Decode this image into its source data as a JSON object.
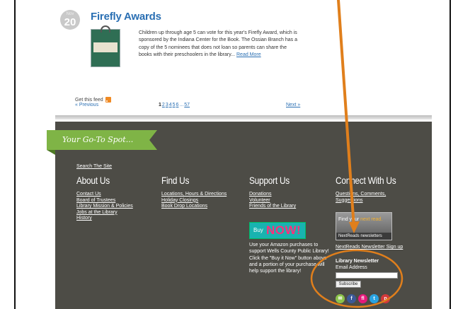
{
  "post": {
    "date_month": "Nov",
    "date_day": "20",
    "title": "Firefly Awards",
    "body": "Children up through age 5 can vote for this year's Firefly Award, which is sponsored by the Indiana Center for the Book. The Ossian Branch has a copy of the 5 nominees that does not loan so parents can share the books with their preschoolers in the library...",
    "read_more": "Read More"
  },
  "feed": {
    "label": "Get this feed",
    "icon": "rss-icon"
  },
  "pagination": {
    "previous": "« Previous",
    "pages": [
      "1",
      "2",
      "3",
      "4",
      "5",
      "6",
      "...",
      "57"
    ],
    "current": "1",
    "next": "Next »"
  },
  "footer": {
    "tagline": "Your Go-To Spot...",
    "search_link": "Search The Site",
    "about": {
      "heading": "About Us",
      "links": [
        "Contact Us",
        "Board of Trustees",
        "Library Mission & Policies",
        "Jobs at the Library",
        "History"
      ]
    },
    "find": {
      "heading": "Find Us",
      "links": [
        "Locations, Hours & Directions",
        "Holiday Closings",
        "Book Drop Locations"
      ]
    },
    "support": {
      "heading": "Support Us",
      "links": [
        "Donations",
        "Volunteer",
        "Friends of the Library"
      ],
      "buy_label": "Buy",
      "buy_now": "NOW!",
      "amazon_text": "Use your Amazon purchases to support Wells County Public Library! Click the \"Buy it Now\" button above and a portion of your purchase will help support the library!"
    },
    "connect": {
      "heading": "Connect With Us",
      "links": [
        "Questions, Comments,",
        "Suggestions"
      ],
      "nr_banner_text1": "Find your",
      "nr_banner_text2": "next read.",
      "nr_banner_bar": "NextReads newsletters",
      "nr_link": "NextReads Newsletter Sign up",
      "newsletter_title": "Library Newsletter",
      "email_label": "Email Address",
      "email_value": "",
      "subscribe": "Subscribe",
      "social": [
        {
          "icon": "email-icon",
          "glyph": "✉",
          "color": "#8cc34a"
        },
        {
          "icon": "facebook-icon",
          "glyph": "f",
          "color": "#3b5998"
        },
        {
          "icon": "flickr-icon",
          "glyph": "fl",
          "color": "#e5197a"
        },
        {
          "icon": "twitter-icon",
          "glyph": "t",
          "color": "#2aa3e0"
        },
        {
          "icon": "pinterest-icon",
          "glyph": "p",
          "color": "#d23a3a"
        }
      ]
    }
  },
  "colors": {
    "footer_bg": "#4d4c46",
    "tagline_green": "#7fb446",
    "link_blue": "#2a6fb3",
    "annotation_orange": "#e07f1c"
  }
}
